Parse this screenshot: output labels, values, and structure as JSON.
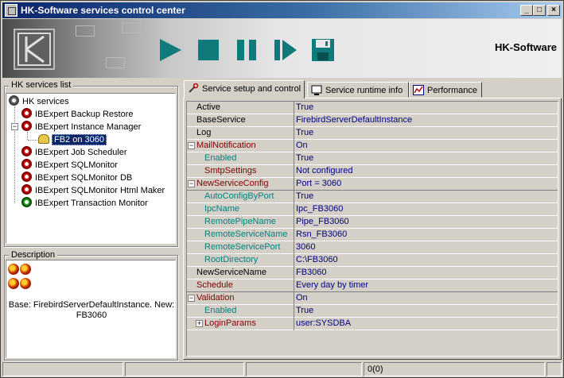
{
  "window": {
    "title": "HK-Software services control center",
    "controls": [
      "_",
      "□",
      "×"
    ]
  },
  "banner": {
    "brand": "HK-Software",
    "tools": [
      "play-icon",
      "stop-icon",
      "pause-icon",
      "step-icon",
      "save-icon"
    ],
    "accent": "#0f7a7a"
  },
  "services_list": {
    "label": "HK services list",
    "root": "HK services",
    "items": [
      {
        "label": "IBExpert Backup Restore",
        "icon": "gear-red-icon"
      },
      {
        "label": "IBExpert Instance Manager",
        "icon": "gear-red-icon"
      },
      {
        "label": "FB2 on 3060",
        "icon": "database-icon"
      },
      {
        "label": "IBExpert Job Scheduler",
        "icon": "gear-red-icon"
      },
      {
        "label": "IBExpert SQLMonitor",
        "icon": "gear-red-icon"
      },
      {
        "label": "IBExpert SQLMonitor DB",
        "icon": "gear-red-icon"
      },
      {
        "label": "IBExpert SQLMonitor Html Maker",
        "icon": "gear-red-icon"
      },
      {
        "label": "IBExpert Transaction Monitor",
        "icon": "gear-green-icon"
      }
    ]
  },
  "description": {
    "label": "Description",
    "text": "Base: FirebirdServerDefaultInstance. New: FB3060"
  },
  "tabs": [
    {
      "label": "Service setup and control",
      "icon": "setup-icon"
    },
    {
      "label": "Service runtime info",
      "icon": "monitor-icon"
    },
    {
      "label": "Performance",
      "icon": "chart-icon"
    }
  ],
  "properties": [
    {
      "name": "Active",
      "value": "True"
    },
    {
      "name": "BaseService",
      "value": "FirebirdServerDefaultInstance"
    },
    {
      "name": "Log",
      "value": "True"
    },
    {
      "name": "MailNotification",
      "value": "On",
      "expander": "−"
    },
    {
      "name": "Enabled",
      "value": "True"
    },
    {
      "name": "SmtpSettings",
      "value": "Not configured"
    },
    {
      "name": "NewServiceConfig",
      "value": "Port = 3060",
      "expander": "−"
    },
    {
      "name": "AutoConfigByPort",
      "value": "True"
    },
    {
      "name": "IpcName",
      "value": "Ipc_FB3060"
    },
    {
      "name": "RemotePipeName",
      "value": "Pipe_FB3060"
    },
    {
      "name": "RemoteServiceName",
      "value": "Rsn_FB3060"
    },
    {
      "name": "RemoteServicePort",
      "value": "3060"
    },
    {
      "name": "RootDirectory",
      "value": "C:\\FB3060"
    },
    {
      "name": "NewServiceName",
      "value": "FB3060"
    },
    {
      "name": "Schedule",
      "value": "Every day by timer"
    },
    {
      "name": "Validation",
      "value": "On",
      "expander": "−"
    },
    {
      "name": "Enabled",
      "value": "True"
    },
    {
      "name": "LoginParams",
      "value": "user:SYSDBA",
      "expander": "+"
    }
  ],
  "statusbar": {
    "cells": [
      "",
      "",
      "",
      "0(0)",
      ""
    ]
  }
}
